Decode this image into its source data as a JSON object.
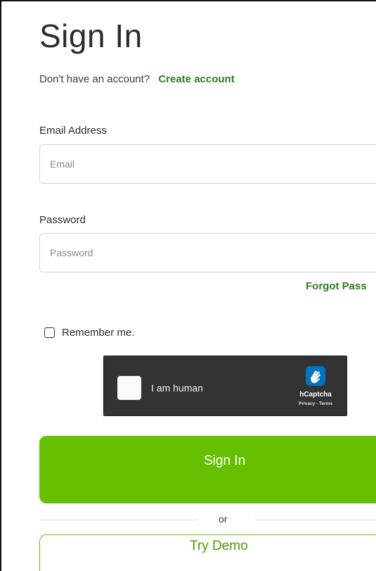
{
  "page": {
    "title": "Sign In"
  },
  "signup": {
    "prompt": "Don't have an account?",
    "link": "Create account"
  },
  "email": {
    "label": "Email Address",
    "placeholder": "Email",
    "value": ""
  },
  "password": {
    "label": "Password",
    "placeholder": "Password",
    "value": ""
  },
  "forgot": {
    "label": "Forgot Pass"
  },
  "remember": {
    "label": "Remember me.",
    "checked": false
  },
  "captcha": {
    "label": "I am human",
    "brand": "hCaptcha",
    "links": "Privacy - Terms",
    "icon": "hcaptcha-hand-icon"
  },
  "actions": {
    "sign_in": "Sign In",
    "divider": "or",
    "try_demo": "Try Demo"
  },
  "colors": {
    "accent": "#66bf00",
    "link": "#2e7d1e",
    "captcha_bg": "#333333"
  }
}
